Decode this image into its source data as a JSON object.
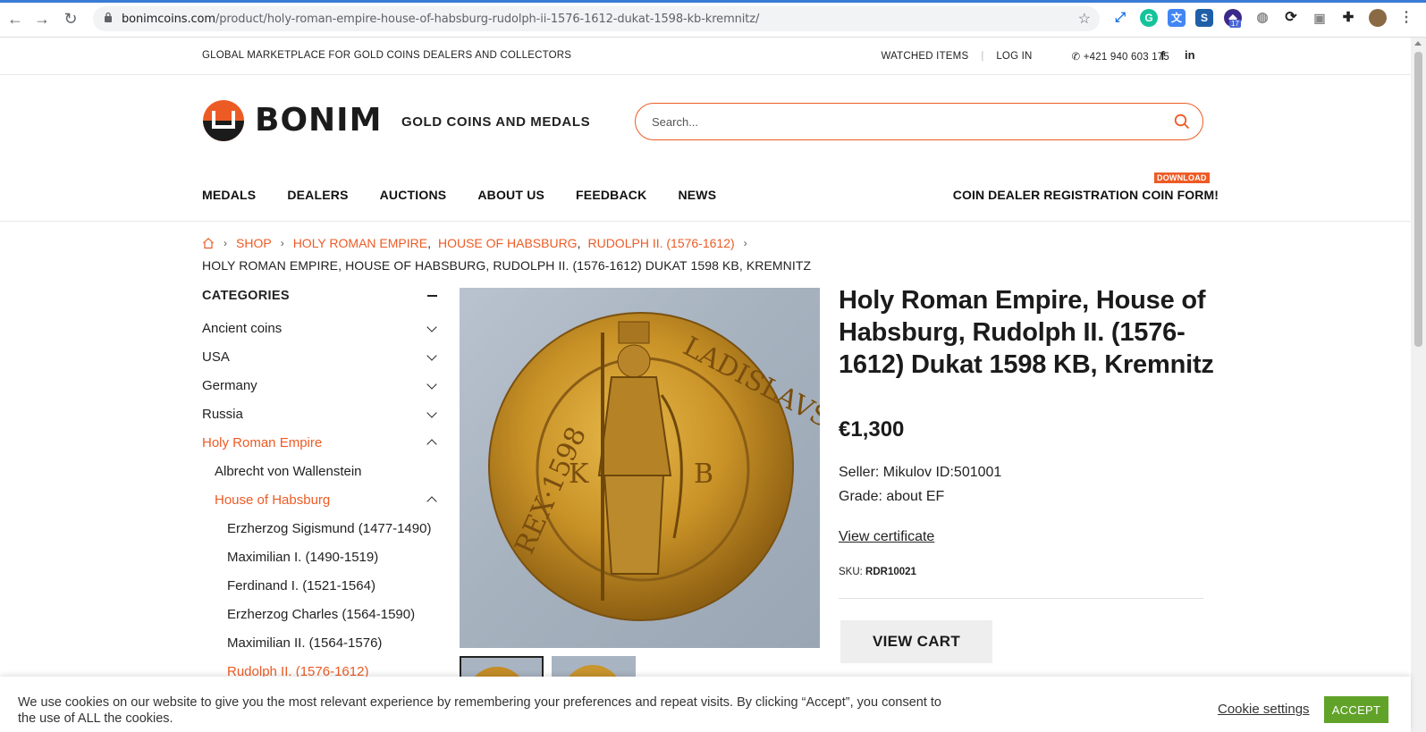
{
  "browser": {
    "url_domain": "bonimcoins.com",
    "url_path": "/product/holy-roman-empire-house-of-habsburg-rudolph-ii-1576-1612-dukat-1598-kb-kremnitz/",
    "extension_badge": "17"
  },
  "topbar": {
    "tagline": "GLOBAL MARKETPLACE FOR GOLD COINS DEALERS AND COLLECTORS",
    "watched": "WATCHED ITEMS",
    "login": "LOG IN",
    "phone": "+421 940 603 175",
    "facebook": "f",
    "linkedin": "in"
  },
  "header": {
    "logo": "BONIM",
    "slogan": "GOLD COINS AND MEDALS",
    "search_placeholder": "Search..."
  },
  "nav": {
    "items": [
      "MEDALS",
      "DEALERS",
      "AUCTIONS",
      "ABOUT US",
      "FEEDBACK",
      "NEWS"
    ],
    "registration": "COIN DEALER REGISTRATION COIN FORM!",
    "download_badge": "DOWNLOAD"
  },
  "breadcrumb": {
    "shop": "SHOP",
    "cat1": "HOLY ROMAN EMPIRE",
    "cat2": "HOUSE OF HABSBURG",
    "cat3": "RUDOLPH II. (1576-1612)",
    "current": "HOLY ROMAN EMPIRE, HOUSE OF HABSBURG, RUDOLPH II. (1576-1612) DUKAT 1598 KB, KREMNITZ"
  },
  "sidebar": {
    "title": "CATEGORIES",
    "items": [
      {
        "label": "Ancient coins"
      },
      {
        "label": "USA"
      },
      {
        "label": "Germany"
      },
      {
        "label": "Russia"
      },
      {
        "label": "Holy Roman Empire"
      },
      {
        "label": "Albrecht von Wallenstein"
      },
      {
        "label": "House of Habsburg"
      },
      {
        "label": "Erzherzog Sigismund (1477-1490)"
      },
      {
        "label": "Maximilian I. (1490-1519)"
      },
      {
        "label": "Ferdinand I. (1521-1564)"
      },
      {
        "label": "Erzherzog Charles (1564-1590)"
      },
      {
        "label": "Maximilian II. (1564-1576)"
      },
      {
        "label": "Rudolph II. (1576-1612)"
      }
    ]
  },
  "product": {
    "title": "Holy Roman Empire, House of Habsburg, Rudolph II. (1576-1612) Dukat 1598 KB, Kremnitz",
    "price": "€1,300",
    "seller": "Seller: Mikulov ID:501001",
    "grade": "Grade: about EF",
    "certificate": "View certificate",
    "sku_label": "SKU:",
    "sku_value": "RDR10021",
    "cart_button": "VIEW CART",
    "coin_legend_top": "LADISLAVS",
    "coin_legend_side": "REX·1598",
    "coin_letters": [
      "K",
      "B"
    ]
  },
  "cookie": {
    "text": "We use cookies on our website to give you the most relevant experience by remembering your preferences and repeat visits. By clicking “Accept”, you consent to the use of ALL the cookies.",
    "settings": "Cookie settings",
    "accept": "ACCEPT"
  },
  "colors": {
    "accent": "#ed5b24",
    "accept_green": "#61a229"
  }
}
